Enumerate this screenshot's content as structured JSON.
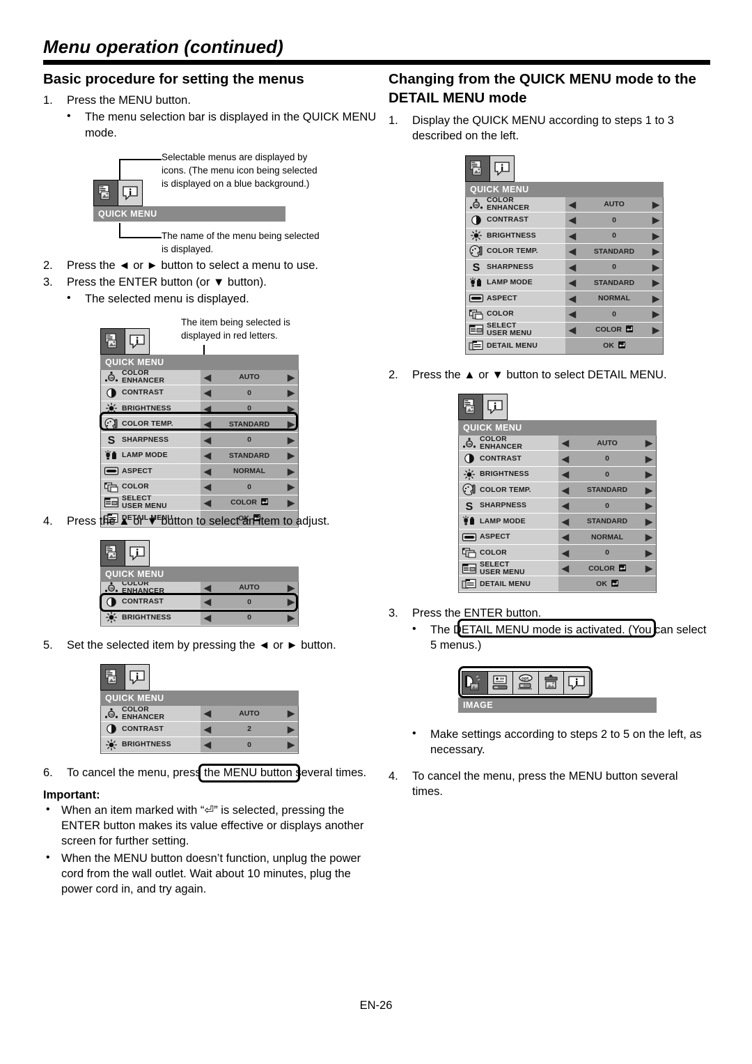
{
  "header": {
    "title": "Menu operation (continued)"
  },
  "left": {
    "section_title": "Basic procedure for setting the menus",
    "step1": {
      "num": "1.",
      "text": "Press the MENU button."
    },
    "step1_sub": "The menu selection bar is displayed in the QUICK MENU mode.",
    "callout_top": "Selectable menus are displayed by icons. (The menu icon being selected is displayed on a blue background.)",
    "callout_bottom": "The name of the menu being selected is displayed.",
    "step2": {
      "num": "2.",
      "text": "Press the ◄ or ► button to select a menu to use."
    },
    "step3": {
      "num": "3.",
      "text": "Press the ENTER button (or ▼ button)."
    },
    "step3_sub": "The selected menu is displayed.",
    "callout_red": "The item being selected is displayed in red letters.",
    "step4": {
      "num": "4.",
      "text": "Press the ▲ or ▼ button to select an item to adjust."
    },
    "step5": {
      "num": "5.",
      "text": "Set the selected item by pressing the ◄ or ► button."
    },
    "step6": {
      "num": "6.",
      "text": "To cancel the menu, press the MENU button several times."
    },
    "important_title": "Important:",
    "important_1": "When an item marked with “⏎” is selected, pressing the ENTER button makes its value effective or displays another screen for further setting.",
    "important_2": "When the MENU button doesn’t function, unplug the power cord from the wall outlet. Wait about 10 minutes, plug the power cord in, and try again."
  },
  "right": {
    "section_title": "Changing from the QUICK MENU mode to the DETAIL MENU mode",
    "step1": {
      "num": "1.",
      "text": "Display the QUICK MENU according to steps 1 to 3 described on the left."
    },
    "step2": {
      "num": "2.",
      "text": "Press the ▲ or ▼ button to select DETAIL MENU."
    },
    "step3": {
      "num": "3.",
      "text": "Press the ENTER button."
    },
    "step3_sub": "The DETAIL MENU mode is activated. (You can select 5 menus.)",
    "bullet_make": "Make settings according to steps 2 to 5 on the left, as necessary.",
    "step4": {
      "num": "4.",
      "text": "To cancel the menu, press the MENU button several times."
    }
  },
  "osd": {
    "quick_menu_title": "QUICK MENU",
    "image_menu_title": "IMAGE",
    "tabs": [
      {
        "icon": "picture-icon",
        "selected": true
      },
      {
        "icon": "info-bubble-icon",
        "selected": false
      }
    ],
    "detail_tabs": [
      {
        "icon": "image-adjust-icon",
        "selected": true
      },
      {
        "icon": "installation-icon",
        "selected": false
      },
      {
        "icon": "option-icon",
        "selected": false
      },
      {
        "icon": "signal-icon",
        "selected": false
      },
      {
        "icon": "info-bubble-icon",
        "selected": false
      }
    ],
    "rows_full": [
      {
        "icon": "color-enhancer-icon",
        "label": "COLOR ENHANCER",
        "label2": "ENHANCER",
        "label1": "COLOR",
        "value": "AUTO",
        "arrows": true
      },
      {
        "icon": "contrast-icon",
        "label1": "CONTRAST",
        "label2": "",
        "value": "0",
        "arrows": true
      },
      {
        "icon": "brightness-icon",
        "label1": "BRIGHTNESS",
        "label2": "",
        "value": "0",
        "arrows": true
      },
      {
        "icon": "color-temp-icon",
        "label1": "COLOR TEMP.",
        "label2": "",
        "value": "STANDARD",
        "arrows": true
      },
      {
        "icon": "sharpness-icon",
        "label1": "SHARPNESS",
        "label2": "",
        "value": "0",
        "arrows": true
      },
      {
        "icon": "lamp-mode-icon",
        "label1": "LAMP MODE",
        "label2": "",
        "value": "STANDARD",
        "arrows": true
      },
      {
        "icon": "aspect-icon",
        "label1": "ASPECT",
        "label2": "",
        "value": "NORMAL",
        "arrows": true
      },
      {
        "icon": "color-icon",
        "label1": "COLOR",
        "label2": "",
        "value": "0",
        "arrows": true
      },
      {
        "icon": "select-user-menu-icon",
        "label1": "SELECT",
        "label2": "USER MENU",
        "value": "COLOR",
        "value_enter": true,
        "arrows": true
      },
      {
        "icon": "detail-menu-icon",
        "label1": "DETAIL MENU",
        "label2": "",
        "value": "OK",
        "value_enter": true,
        "arrows": false
      }
    ],
    "rows_short_step4": [
      {
        "icon": "color-enhancer-icon",
        "label1": "COLOR",
        "label2": "ENHANCER",
        "value": "AUTO",
        "arrows": true
      },
      {
        "icon": "contrast-icon",
        "label1": "CONTRAST",
        "label2": "",
        "value": "0",
        "arrows": true
      },
      {
        "icon": "brightness-icon",
        "label1": "BRIGHTNESS",
        "label2": "",
        "value": "0",
        "arrows": true
      }
    ],
    "rows_short_step5": [
      {
        "icon": "color-enhancer-icon",
        "label1": "COLOR",
        "label2": "ENHANCER",
        "value": "AUTO",
        "arrows": true
      },
      {
        "icon": "contrast-icon",
        "label1": "CONTRAST",
        "label2": "",
        "value": "2",
        "arrows": true
      },
      {
        "icon": "brightness-icon",
        "label1": "BRIGHTNESS",
        "label2": "",
        "value": "0",
        "arrows": true
      }
    ],
    "colors": {
      "title_bar": "#8a8a8a",
      "row_label_bg": "#cfcfcf",
      "row_value_bg": "#a9a9a9",
      "tab_selected_bg": "#5e5e5e",
      "tab_bg": "#d4d4d4"
    }
  },
  "footer": {
    "page_label": "EN-26"
  }
}
